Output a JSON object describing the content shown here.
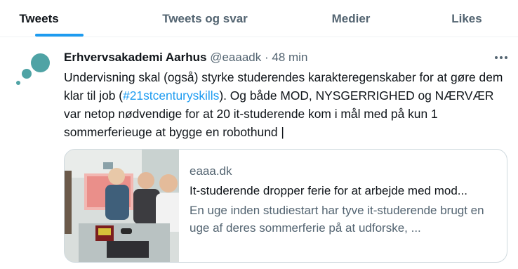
{
  "tabs": [
    {
      "label": "Tweets",
      "active": true
    },
    {
      "label": "Tweets og svar",
      "active": false
    },
    {
      "label": "Medier",
      "active": false
    },
    {
      "label": "Likes",
      "active": false
    }
  ],
  "tweet": {
    "author_name": "Erhvervsakademi Aarhus",
    "handle": "@eaaadk",
    "separator": "·",
    "time": "48 min",
    "body_part1": "Undervisning skal (også) styrke studerendes karakteregenskaber for at gøre dem klar til job (",
    "hashtag": "#21stcenturyskills",
    "body_part2": "). Og både MOD, NYSGERRIGHED og NÆRVÆR var netop nødvendige for at 20 it-studerende kom i mål med på kun 1 sommerferieuge at bygge en robothund |",
    "more_icon": "more-horizontal-icon",
    "card": {
      "domain": "eaaa.dk",
      "title": "It-studerende dropper ferie for at arbejde med mod...",
      "description": "En uge inden studiestart har tyve it-studerende brugt en uge af deres sommerferie på at udforske, ..."
    }
  },
  "colors": {
    "accent": "#1d9bf0",
    "avatar": "#4fa3a5",
    "secondary_text": "#536471",
    "primary_text": "#0f1419",
    "border": "#cfd9de"
  }
}
